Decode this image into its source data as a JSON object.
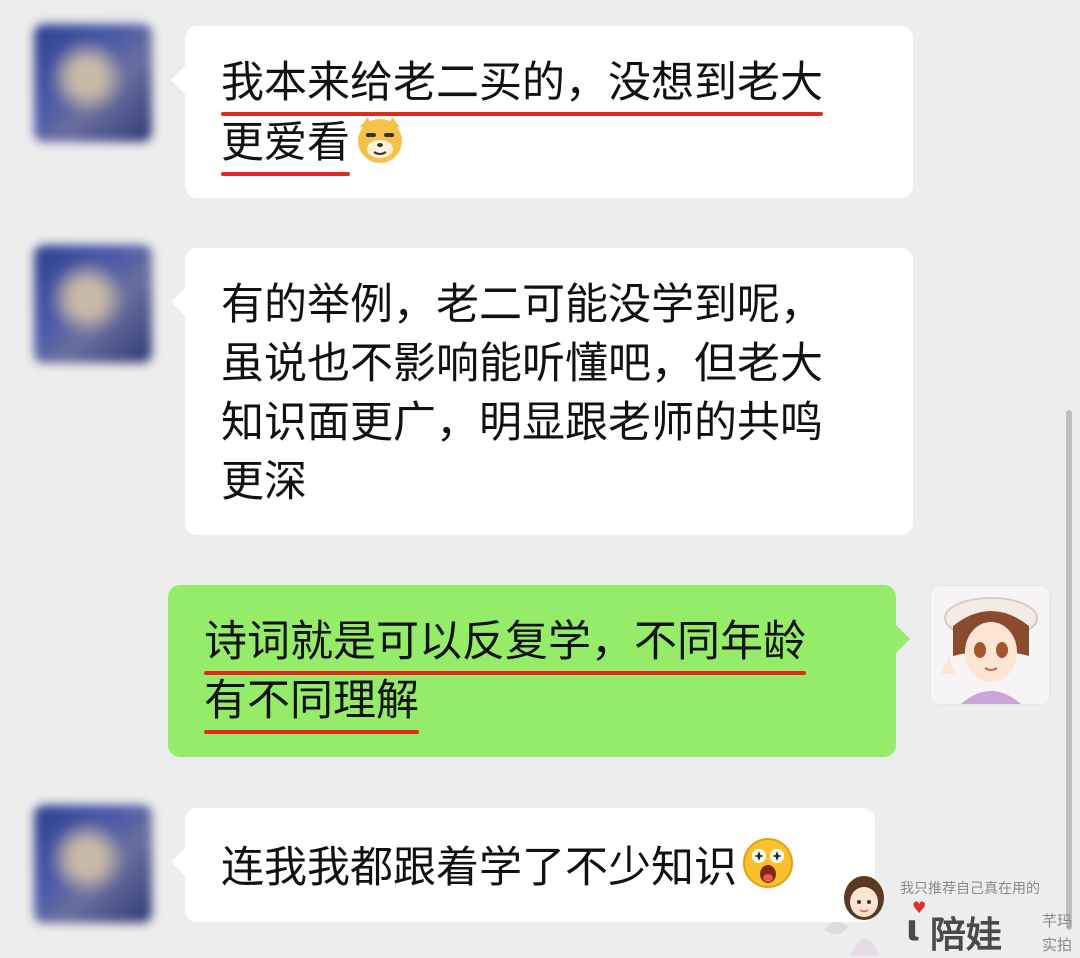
{
  "messages": [
    {
      "side": "left",
      "lines": [
        "我本来给老二买的，没想到老大",
        "更爱看"
      ],
      "emoji": "doge-emoji"
    },
    {
      "side": "left",
      "lines": [
        "有的举例，老二可能没学到呢，",
        "虽说也不影响能听懂吧，但老大",
        "知识面更广，明显跟老师的共鸣",
        "更深"
      ]
    },
    {
      "side": "right",
      "lines": [
        "诗词就是可以反复学，不同年龄",
        "有不同理解"
      ]
    },
    {
      "side": "left",
      "lines": [
        "连我我都跟着学了不少知识"
      ],
      "emoji": "star-eyes-emoji"
    }
  ],
  "watermark": {
    "tagline": "我只推荐自己真在用的",
    "brand": "陪娃",
    "side1": "芊玛",
    "side2": "实拍"
  },
  "colors": {
    "background": "#ededed",
    "bubble_left": "#ffffff",
    "bubble_right": "#95ec69",
    "underline": "#e02a1f"
  }
}
